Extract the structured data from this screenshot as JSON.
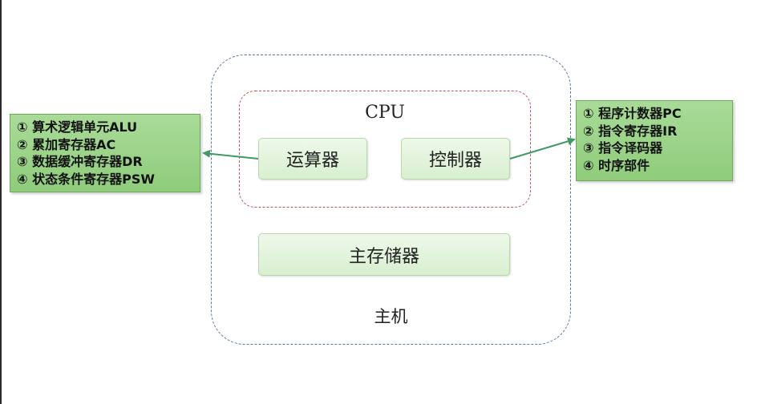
{
  "diagram": {
    "host": {
      "label": "主机"
    },
    "cpu": {
      "label": "CPU"
    },
    "components": {
      "alu": "运算器",
      "control": "控制器",
      "memory": "主存储器"
    },
    "alu_parts": [
      "① 算术逻辑单元ALU",
      "② 累加寄存器AC",
      "③ 数据缓冲寄存器DR",
      "④ 状态条件寄存器PSW"
    ],
    "control_parts": [
      "① 程序计数器PC",
      "② 指令寄存器IR",
      "③ 指令译码器",
      "④ 时序部件"
    ],
    "colors": {
      "arrow": "#3f9a62",
      "host_border": "#5a78a8",
      "cpu_border": "#c2575e",
      "list_fill": "#9dd48a"
    }
  }
}
